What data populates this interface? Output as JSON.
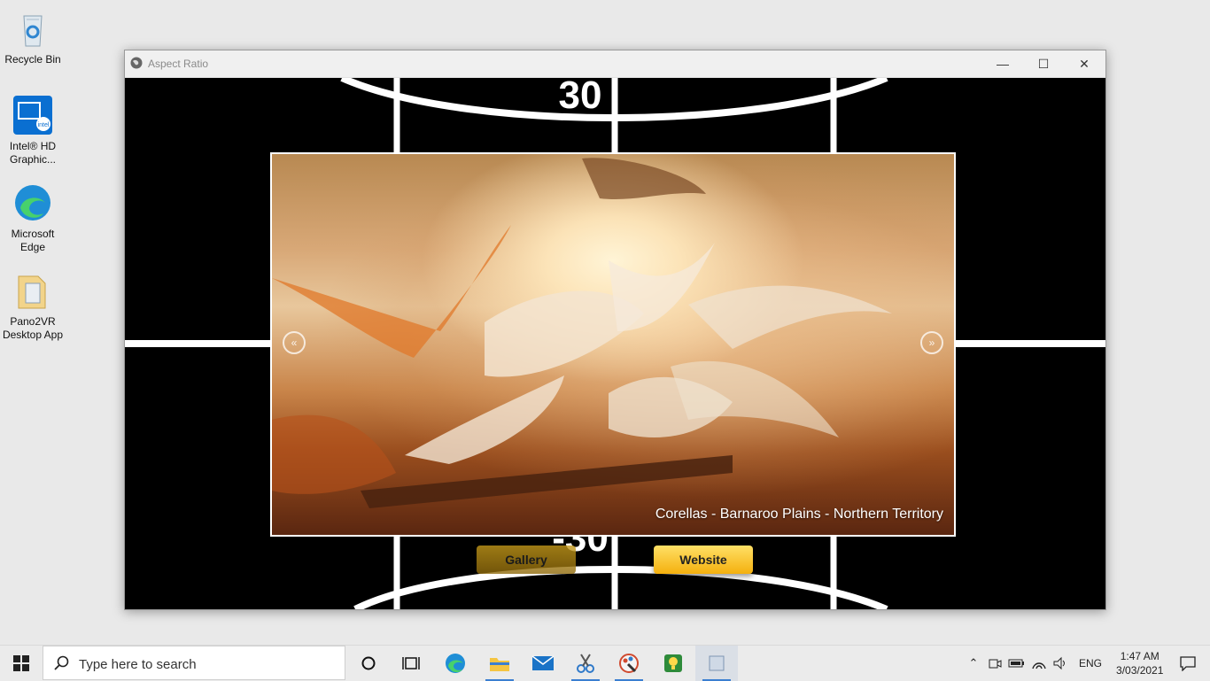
{
  "desktop": {
    "icons": [
      {
        "label_line1": "Recycle Bin",
        "label_line2": ""
      },
      {
        "label_line1": "Intel® HD",
        "label_line2": "Graphic..."
      },
      {
        "label_line1": "Microsoft",
        "label_line2": "Edge"
      },
      {
        "label_line1": "Pano2VR",
        "label_line2": "Desktop App"
      }
    ]
  },
  "window": {
    "title": "Aspect Ratio",
    "controls": {
      "minimize": "—",
      "maximize": "☐",
      "close": "✕"
    }
  },
  "viewer": {
    "compass_top": "30",
    "compass_bottom": "-30",
    "caption": "Corellas - Barnaroo Plains - Northern Territory",
    "prev_glyph": "«",
    "next_glyph": "»",
    "buttons": {
      "gallery": "Gallery",
      "website": "Website"
    }
  },
  "taskbar": {
    "search_placeholder": "Type here to search",
    "tray": {
      "lang": "ENG",
      "time": "1:47 AM",
      "date": "3/03/2021"
    }
  }
}
